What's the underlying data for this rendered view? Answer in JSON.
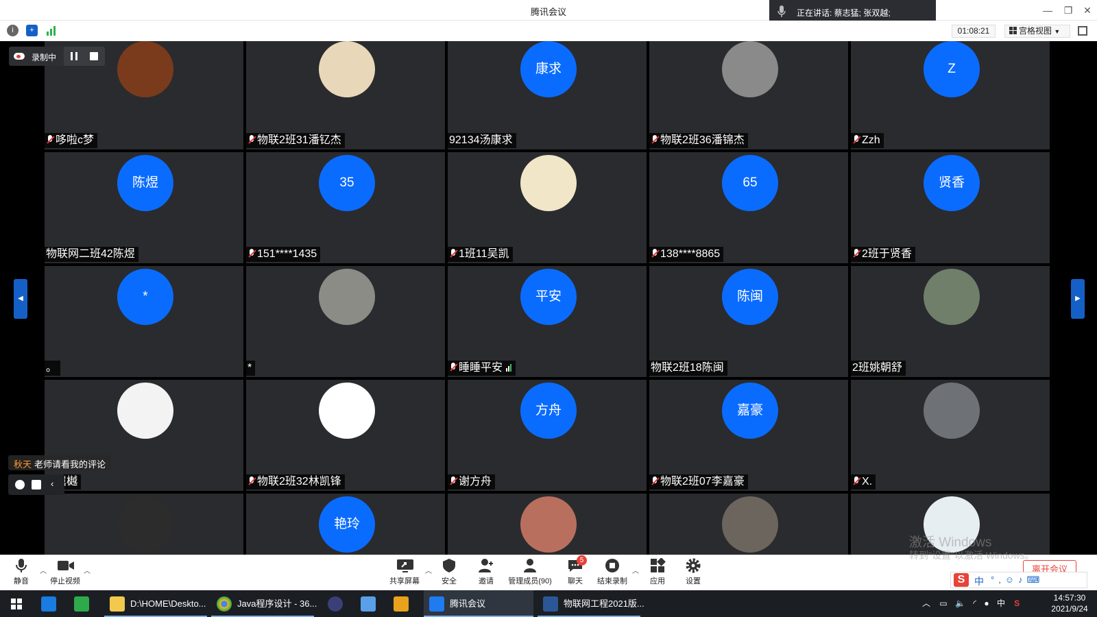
{
  "window": {
    "title": "腾讯会议",
    "speaking": "正在讲话: 蔡志猛; 张双越;",
    "timer": "01:08:21",
    "grid_view": "宫格视图"
  },
  "recording": {
    "label": "录制中"
  },
  "participants": [
    {
      "name": "哆啦c梦",
      "avatar_text": "",
      "muted": true,
      "photo": "#7a3b1c"
    },
    {
      "name": "物联2班31潘钇杰",
      "avatar_text": "",
      "muted": true,
      "photo": "#e9d7b9"
    },
    {
      "name": "92134汤康求",
      "avatar_text": "康求",
      "muted": false
    },
    {
      "name": "物联2班36潘锦杰",
      "avatar_text": "",
      "muted": true,
      "photo": "#8a8a8a"
    },
    {
      "name": "Zzh",
      "avatar_text": "Z",
      "muted": true
    },
    {
      "name": "物联网二班42陈煜",
      "avatar_text": "陈煜",
      "muted": false
    },
    {
      "name": "151****1435",
      "avatar_text": "35",
      "muted": true
    },
    {
      "name": "1班11吴凯",
      "avatar_text": "",
      "muted": true,
      "photo": "#f1e6c8"
    },
    {
      "name": "138****8865",
      "avatar_text": "65",
      "muted": true
    },
    {
      "name": "2班于贤香",
      "avatar_text": "贤香",
      "muted": true
    },
    {
      "name": "。",
      "avatar_text": "*",
      "muted": false
    },
    {
      "name": "*",
      "avatar_text": "",
      "muted": false,
      "photo": "#8c8c86"
    },
    {
      "name": "睡睡平安",
      "avatar_text": "平安",
      "muted": true,
      "signal": true
    },
    {
      "name": "物联2班18陈闽",
      "avatar_text": "陈闽",
      "muted": false
    },
    {
      "name": "2班姚朝舒",
      "avatar_text": "",
      "muted": false,
      "photo": "#6f7f6a"
    },
    {
      "name": "屈樾",
      "avatar_text": "",
      "muted": true,
      "photo": "#f3f3f3"
    },
    {
      "name": "物联2班32林凯锋",
      "avatar_text": "",
      "muted": true,
      "photo": "#ffffff"
    },
    {
      "name": "谢方舟",
      "avatar_text": "方舟",
      "muted": true
    },
    {
      "name": "物联2班07李嘉豪",
      "avatar_text": "嘉豪",
      "muted": true
    },
    {
      "name": "X.",
      "avatar_text": "",
      "muted": true,
      "photo": "#6e7276"
    },
    {
      "name": "",
      "avatar_text": "",
      "muted": false,
      "photo": "#2c2c2c"
    },
    {
      "name": "",
      "avatar_text": "艳玲",
      "muted": false
    },
    {
      "name": "",
      "avatar_text": "",
      "muted": false,
      "photo": "#b86f5e"
    },
    {
      "name": "",
      "avatar_text": "",
      "muted": false,
      "photo": "#6b655e"
    },
    {
      "name": "",
      "avatar_text": "",
      "muted": false,
      "photo": "#e7eef2"
    }
  ],
  "chat": {
    "sender": "秋天",
    "message": "老师请看我的评论"
  },
  "toolbar": {
    "mute": "静音",
    "stop_video": "停止视频",
    "share": "共享屏幕",
    "security": "安全",
    "invite": "邀请",
    "members": "管理成员(90)",
    "chat": "聊天",
    "chat_badge": "5",
    "end_record": "结束录制",
    "apps": "应用",
    "settings": "设置",
    "leave": "离开会议"
  },
  "watermark": {
    "line1": "激活 Windows",
    "line2": "转到\"设置\"以激活 Windows。"
  },
  "ime": {
    "lang": "中"
  },
  "taskbar": {
    "items": [
      "D:\\HOME\\Deskto...",
      "Java程序设计 - 36...",
      "腾讯会议",
      "物联网工程2021版..."
    ],
    "tray_lang": "中",
    "time": "14:57:30",
    "date": "2021/9/24"
  }
}
